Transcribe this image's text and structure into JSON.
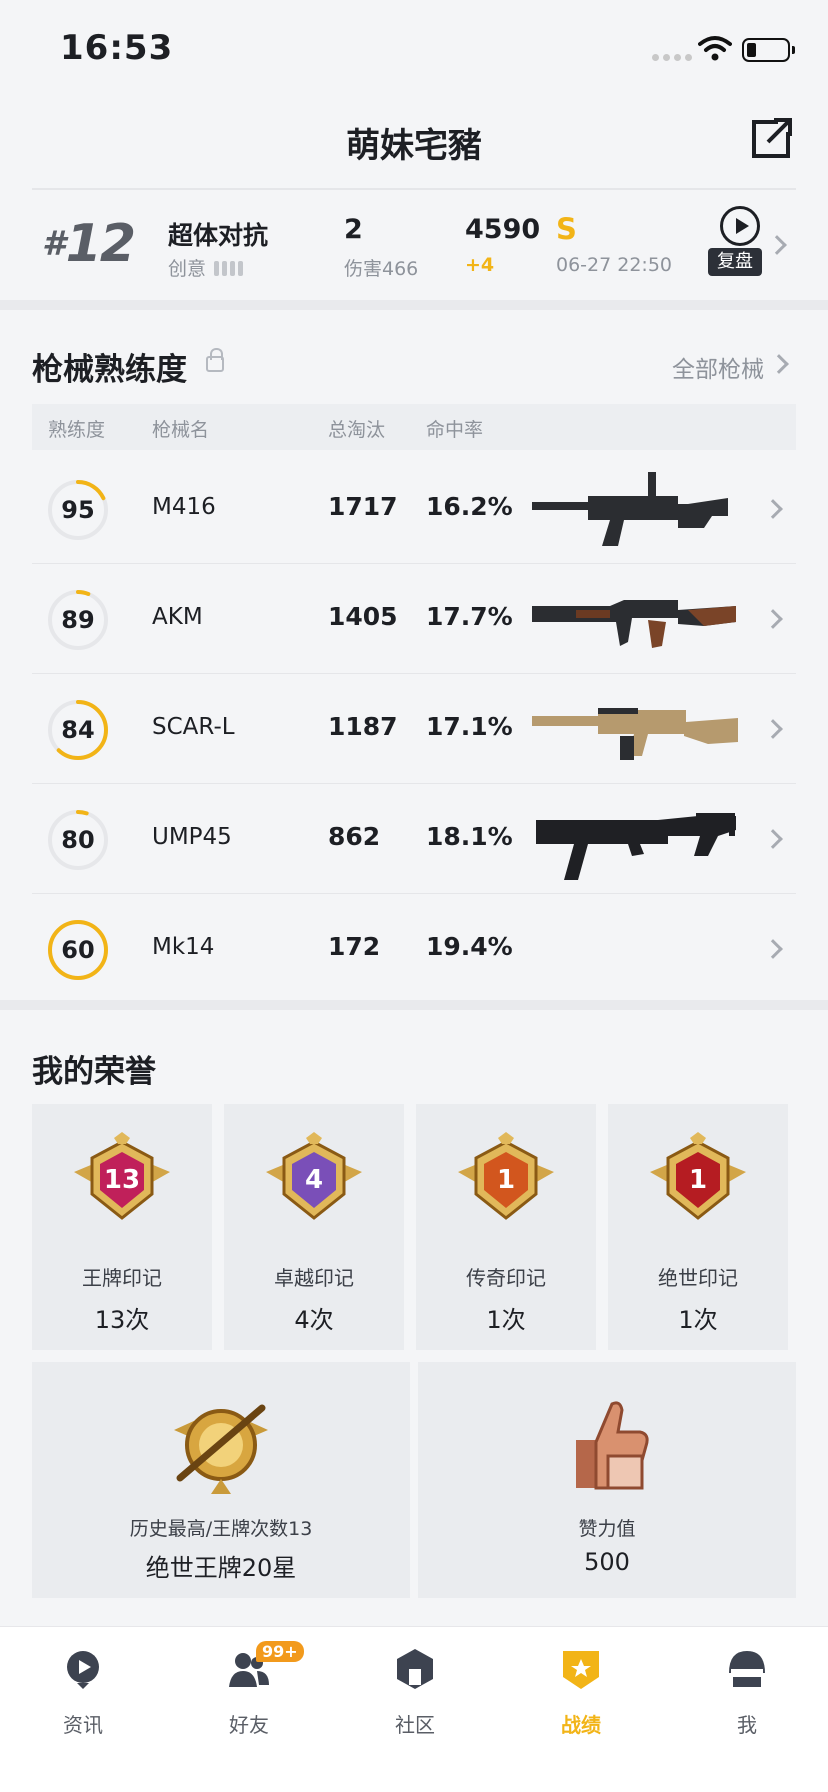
{
  "status_bar": {
    "time": "16:53"
  },
  "header": {
    "title": "萌妹宅豬"
  },
  "recent_match": {
    "rank": "12",
    "rank_prefix": "#",
    "mode": "超体对抗",
    "creator": "创意",
    "kills": "2",
    "damage": "伤害466",
    "score": "4590",
    "score_change": "+4",
    "grade": "S",
    "datetime": "06-27 22:50",
    "replay_label": "复盘"
  },
  "weapons": {
    "title": "枪械熟练度",
    "all_link": "全部枪械",
    "headers": [
      "熟练度",
      "枪械名",
      "总淘汰",
      "命中率"
    ],
    "rows": [
      {
        "mastery": "95",
        "mastery_fraction": 0.18,
        "name": "M416",
        "eliminations": "1717",
        "accuracy": "16.2%",
        "image": "m416-rifle"
      },
      {
        "mastery": "89",
        "mastery_fraction": 0.06,
        "name": "AKM",
        "eliminations": "1405",
        "accuracy": "17.7%",
        "image": "akm-rifle"
      },
      {
        "mastery": "84",
        "mastery_fraction": 0.62,
        "name": "SCAR-L",
        "eliminations": "1187",
        "accuracy": "17.1%",
        "image": "scar-l-rifle"
      },
      {
        "mastery": "80",
        "mastery_fraction": 0.05,
        "name": "UMP45",
        "eliminations": "862",
        "accuracy": "18.1%",
        "image": "ump45-smg"
      },
      {
        "mastery": "60",
        "mastery_fraction": 1.0,
        "name": "Mk14",
        "eliminations": "172",
        "accuracy": "19.4%",
        "image": ""
      }
    ]
  },
  "honors": {
    "title": "我的荣誉",
    "badges": [
      {
        "label": "王牌印记",
        "count": "13次",
        "number": "13",
        "color": "#c0205a"
      },
      {
        "label": "卓越印记",
        "count": "4次",
        "number": "4",
        "color": "#7a4fb8"
      },
      {
        "label": "传奇印记",
        "count": "1次",
        "number": "1",
        "color": "#d2561e"
      },
      {
        "label": "绝世印记",
        "count": "1次",
        "number": "1",
        "color": "#b51c22"
      }
    ],
    "highest": {
      "label": "历史最高/王牌次数13",
      "value": "绝世王牌20星"
    },
    "likes": {
      "label": "赞力值",
      "value": "500"
    }
  },
  "tabs": [
    {
      "label": "资讯",
      "icon": "news-icon"
    },
    {
      "label": "好友",
      "icon": "friends-icon",
      "badge": "99+"
    },
    {
      "label": "社区",
      "icon": "community-icon"
    },
    {
      "label": "战绩",
      "icon": "records-icon",
      "active": true
    },
    {
      "label": "我",
      "icon": "profile-icon"
    }
  ],
  "colors": {
    "accent": "#f2b417",
    "text": "#1d1f24",
    "muted": "#8e939b"
  }
}
